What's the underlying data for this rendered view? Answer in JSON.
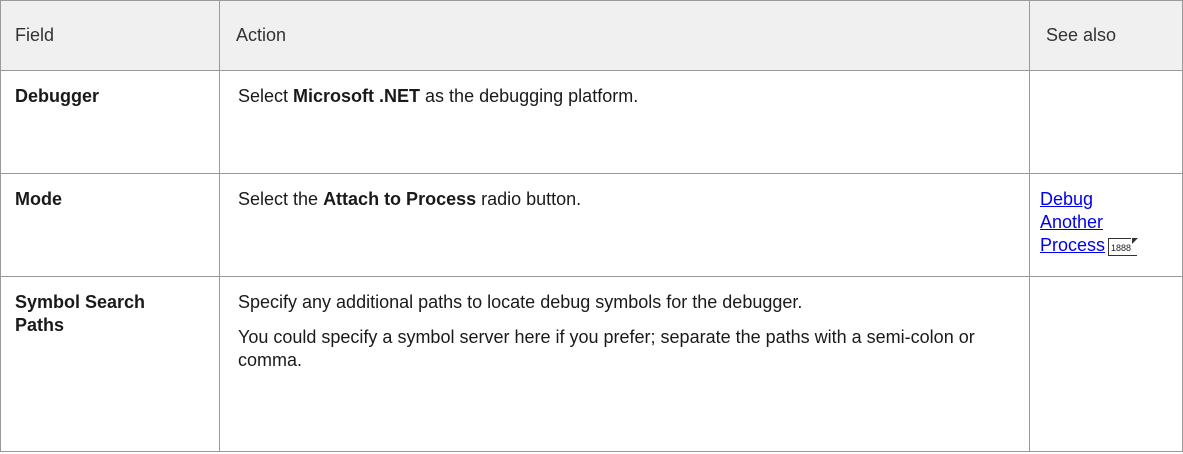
{
  "table": {
    "headers": {
      "field": "Field",
      "action": "Action",
      "see_also": "See also"
    },
    "rows": [
      {
        "field": "Debugger",
        "action_pre": "Select ",
        "action_bold": "Microsoft .NET",
        "action_post": " as the debugging platform.",
        "see_also": ""
      },
      {
        "field": "Mode",
        "action_pre": "Select the ",
        "action_bold": "Attach to Process",
        "action_post": " radio button.",
        "see_also_lines": [
          "Debug",
          "Another",
          "Process"
        ],
        "see_also_page": "1888"
      },
      {
        "field_lines": [
          "Symbol Search",
          "Paths"
        ],
        "action_p1": "Specify any additional paths to locate debug symbols for the debugger.",
        "action_p2": "You could specify a symbol server here if you prefer; separate the paths with a semi-colon or comma.",
        "see_also": ""
      }
    ]
  }
}
